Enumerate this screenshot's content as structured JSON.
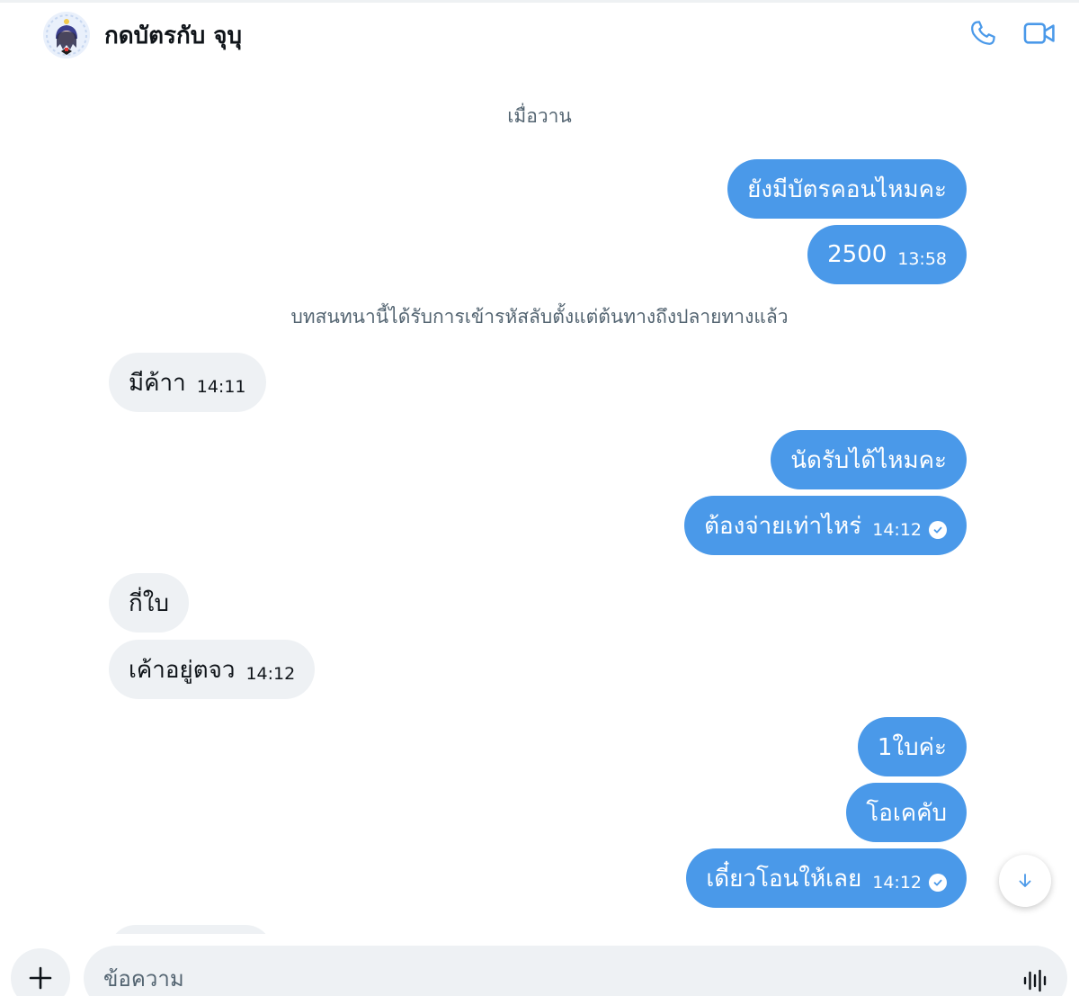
{
  "header": {
    "contact_name": "กดบัตรกับ จุบุ",
    "avatar_icon": "avatar-illustration",
    "call_icon": "phone-icon",
    "video_icon": "video-camera-icon",
    "accent_color": "#4a99e9"
  },
  "conversation": {
    "day_separator": "เมื่อวาน",
    "encryption_notice": "บทสนทนานี้ได้รับการเข้ารหัสลับตั้งแต่ต้นทางถึงปลายทางแล้ว",
    "messages": [
      {
        "direction": "out",
        "text": "ยังมีบัตรคอนไหมคะ",
        "time": ""
      },
      {
        "direction": "out",
        "text": "2500",
        "time": "13:58"
      },
      {
        "direction": "in",
        "text": "มีค้าา",
        "time": "14:11"
      },
      {
        "direction": "out",
        "text": "นัดรับได้ไหมคะ",
        "time": ""
      },
      {
        "direction": "out",
        "text": "ต้องจ่ายเท่าไหร่",
        "time": "14:12",
        "read": true
      },
      {
        "direction": "in",
        "text": "กี่ใบ",
        "time": ""
      },
      {
        "direction": "in",
        "text": "เค้าอยู่ตจว",
        "time": "14:12"
      },
      {
        "direction": "out",
        "text": "1ใบค่ะ",
        "time": ""
      },
      {
        "direction": "out",
        "text": "โอเคคับ",
        "time": ""
      },
      {
        "direction": "out",
        "text": "เดี๋ยวโอนให้เลย",
        "time": "14:12",
        "read": true
      }
    ],
    "scroll_down_icon": "arrow-down-icon"
  },
  "composer": {
    "placeholder": "ข้อความ",
    "value": "",
    "add_icon": "plus-icon",
    "voice_icon": "voice-waveform-icon"
  },
  "colors": {
    "outgoing_bubble": "#4a99e9",
    "incoming_bubble": "#eef1f4",
    "muted_text": "#536471"
  }
}
